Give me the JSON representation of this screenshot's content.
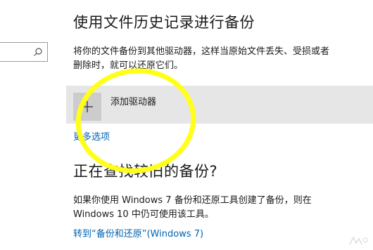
{
  "search": {
    "placeholder": "",
    "icon": "search-icon"
  },
  "backup_section": {
    "title": "使用文件历史记录进行备份",
    "description_line1": "将你的文件备份到其他驱动器，这样当原始文件丢失、受损或者",
    "description_line2": "删除时，就可以还原它们。",
    "add_drive_label": "添加驱动器",
    "add_drive_icon": "plus-icon",
    "more_options": "更多选项"
  },
  "old_backup_section": {
    "title": "正在查找较旧的备份?",
    "description_line1": "如果你使用 Windows 7 备份和还原工具创建了备份，则在",
    "description_line2": "Windows 10 中仍可使用该工具。",
    "goto_link": "转到“备份和还原”(Windows 7)"
  },
  "colors": {
    "link": "#0063b1",
    "row_bg": "#e6e6e6",
    "tile_bg": "#cccccc",
    "highlight": "#ffff1a"
  }
}
